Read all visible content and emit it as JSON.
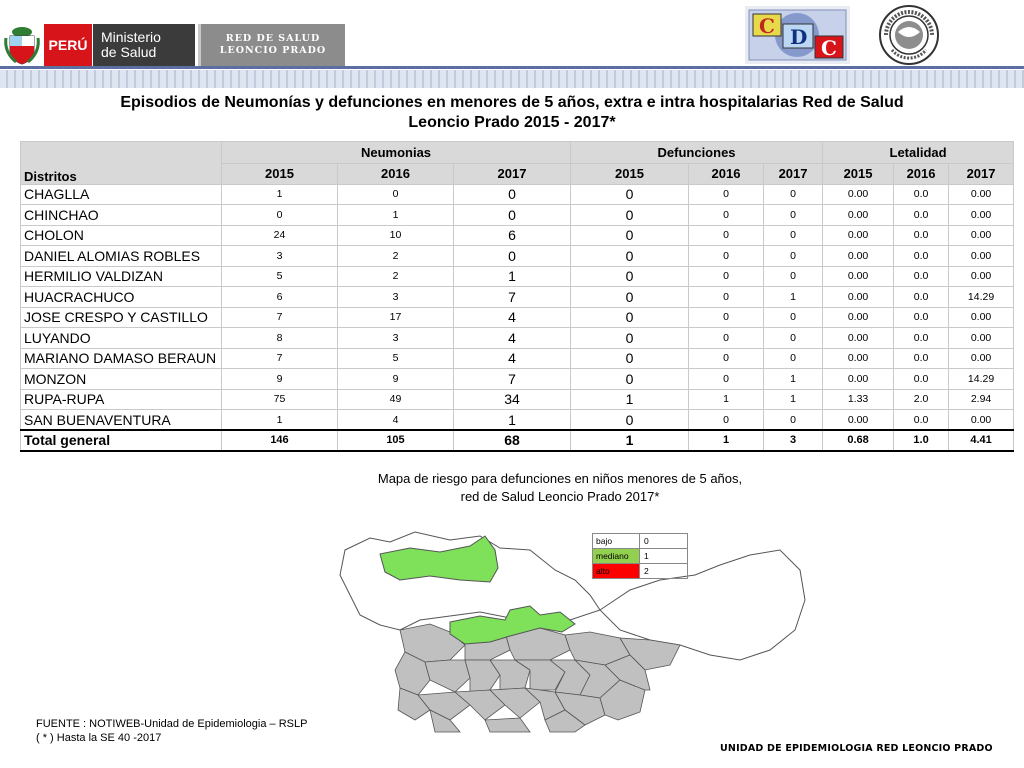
{
  "header": {
    "peru_label": "PERÚ",
    "ministerio_line1": "Ministerio",
    "ministerio_line2": "de Salud",
    "red_line1": "RED DE SALUD",
    "red_line2": "LEONCIO PRADO",
    "cdc_logo": "CDC",
    "seal_text": "RED NACIONAL DE EPIDEMIOLOGÍA · RENACE"
  },
  "title": {
    "line1": "Episodios de Neumonías y  defunciones en menores de 5 años, extra e intra hospitalarias   Red de Salud",
    "line2": "Leoncio Prado 2015 - 2017*"
  },
  "table": {
    "district_header": "Distritos",
    "groups": [
      "Neumonias",
      "Defunciones",
      "Letalidad"
    ],
    "years": [
      "2015",
      "2016",
      "2017",
      "2015",
      "2016",
      "2017",
      "2015",
      "2016",
      "2017"
    ],
    "rows": [
      {
        "name": "CHAGLLA",
        "n15": "1",
        "n16": "0",
        "n17": "0",
        "d15": "0",
        "d16": "0",
        "d17": "0",
        "l15": "0.00",
        "l16": "0.0",
        "l17": "0.00"
      },
      {
        "name": "CHINCHAO",
        "n15": "0",
        "n16": "1",
        "n17": "0",
        "d15": "0",
        "d16": "0",
        "d17": "0",
        "l15": "0.00",
        "l16": "0.0",
        "l17": "0.00"
      },
      {
        "name": "CHOLON",
        "n15": "24",
        "n16": "10",
        "n17": "6",
        "d15": "0",
        "d16": "0",
        "d17": "0",
        "l15": "0.00",
        "l16": "0.0",
        "l17": "0.00"
      },
      {
        "name": "DANIEL ALOMIAS ROBLES",
        "n15": "3",
        "n16": "2",
        "n17": "0",
        "d15": "0",
        "d16": "0",
        "d17": "0",
        "l15": "0.00",
        "l16": "0.0",
        "l17": "0.00"
      },
      {
        "name": "HERMILIO VALDIZAN",
        "n15": "5",
        "n16": "2",
        "n17": "1",
        "d15": "0",
        "d16": "0",
        "d17": "0",
        "l15": "0.00",
        "l16": "0.0",
        "l17": "0.00"
      },
      {
        "name": "HUACRACHUCO",
        "n15": "6",
        "n16": "3",
        "n17": "7",
        "d15": "0",
        "d16": "0",
        "d17": "1",
        "l15": "0.00",
        "l16": "0.0",
        "l17": "14.29"
      },
      {
        "name": "JOSE CRESPO Y CASTILLO",
        "n15": "7",
        "n16": "17",
        "n17": "4",
        "d15": "0",
        "d16": "0",
        "d17": "0",
        "l15": "0.00",
        "l16": "0.0",
        "l17": "0.00"
      },
      {
        "name": "LUYANDO",
        "n15": "8",
        "n16": "3",
        "n17": "4",
        "d15": "0",
        "d16": "0",
        "d17": "0",
        "l15": "0.00",
        "l16": "0.0",
        "l17": "0.00"
      },
      {
        "name": "MARIANO DAMASO BERAUN",
        "n15": "7",
        "n16": "5",
        "n17": "4",
        "d15": "0",
        "d16": "0",
        "d17": "0",
        "l15": "0.00",
        "l16": "0.0",
        "l17": "0.00"
      },
      {
        "name": "MONZON",
        "n15": "9",
        "n16": "9",
        "n17": "7",
        "d15": "0",
        "d16": "0",
        "d17": "1",
        "l15": "0.00",
        "l16": "0.0",
        "l17": "14.29"
      },
      {
        "name": "RUPA-RUPA",
        "n15": "75",
        "n16": "49",
        "n17": "34",
        "d15": "1",
        "d16": "1",
        "d17": "1",
        "l15": "1.33",
        "l16": "2.0",
        "l17": "2.94"
      },
      {
        "name": "SAN BUENAVENTURA",
        "n15": "1",
        "n16": "4",
        "n17": "1",
        "d15": "0",
        "d16": "0",
        "d17": "0",
        "l15": "0.00",
        "l16": "0.0",
        "l17": "0.00"
      }
    ],
    "total": {
      "name": "Total general",
      "n15": "146",
      "n16": "105",
      "n17": "68",
      "d15": "1",
      "d16": "1",
      "d17": "3",
      "l15": "0.68",
      "l16": "1.0",
      "l17": "4.41"
    }
  },
  "map": {
    "caption_line1": "Mapa de riesgo para  defunciones en niños menores de 5 años,",
    "caption_line2": "red de Salud Leoncio Prado 2017*",
    "legend": [
      {
        "label": "bajo",
        "value": "0",
        "color": "#ffffff"
      },
      {
        "label": "mediano",
        "value": "1",
        "color": "#92d050"
      },
      {
        "label": "alto",
        "value": "2",
        "color": "#ff0000"
      }
    ],
    "colors": {
      "base": "#c0c0c0",
      "highlight": "#7fe05a",
      "outline": "#555555"
    }
  },
  "source": {
    "line1": "FUENTE : NOTIWEB-Unidad de Epidemiologia – RSLP",
    "line2": "( * ) Hasta la SE  40 -2017"
  },
  "footer": "UNIDAD  DE EPIDEMIOLOGIA RED LEONCIO PRADO"
}
